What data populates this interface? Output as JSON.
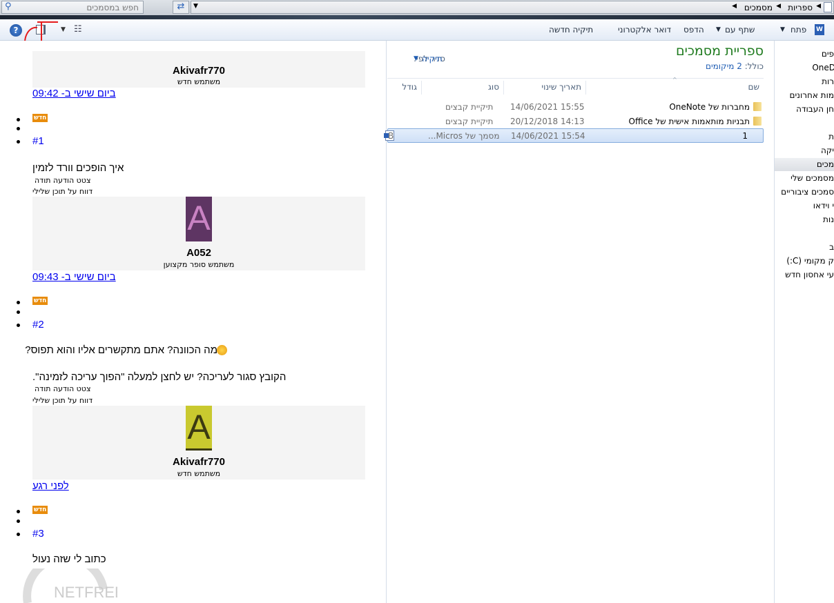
{
  "topbar": {
    "search_placeholder": "חפש במסמכים",
    "breadcrumb": [
      "ספריות",
      "מסמכים"
    ]
  },
  "toolbar": {
    "open": "פתח",
    "share": "שתף עם",
    "print": "הדפס",
    "email": "דואר אלקטרוני",
    "new_folder": "תיקיה חדשה"
  },
  "library": {
    "title": "ספריית מסמכים",
    "includes_label": "כולל:",
    "includes_value": "2 מיקומים",
    "arrange_label": "סדר לפי:",
    "arrange_value": "תיקיה"
  },
  "columns": {
    "name": "שם",
    "date": "תאריך שינוי",
    "type": "סוג",
    "size": "גודל"
  },
  "files": [
    {
      "name": "OneNote מחברות של",
      "date": "14/06/2021 15:55",
      "type": "תיקיית קבצים",
      "size": "",
      "icon": "folder-icon"
    },
    {
      "name": "תבניות מותאמות אישית של Office",
      "date": "20/12/2018 14:13",
      "type": "תיקיית קבצים",
      "size": "",
      "icon": "folder-icon"
    },
    {
      "name": "1",
      "date": "14/06/2021 15:54",
      "type": "...Micros מסמך של",
      "size": "B",
      "icon": "word-doc-icon",
      "selected": true
    }
  ],
  "nav": [
    "פים",
    "OneD",
    "רות",
    "מות אחרונים",
    "חן העבודה",
    "ת",
    "יקה",
    "מכים",
    "מסמכים שלי",
    "סמכים ציבוריים",
    "י וידאו",
    "נות",
    "ב",
    "ק מקומי (C:)",
    "עי אחסון חדש"
  ],
  "forum": {
    "new_badge": "חדש",
    "posts": [
      {
        "user": "Akivafr770",
        "rank": "משתמש חדש",
        "time": "ביום שישי ב- 09:42",
        "number": "#1",
        "body": [
          "איך הופכים וורד לזמין"
        ],
        "actions": [
          "צטט הודעה תודה",
          "דווח על תוכן שלילי"
        ]
      },
      {
        "user": "A052",
        "avatar_letter": "A",
        "avatar_color": "#5e3563",
        "rank": "משתמש סופר מקצוען",
        "time": "ביום שישי ב- 09:43",
        "number": "#2",
        "body": [
          "מה הכוונה? אתם מתקשרים אליו והוא תפוס?",
          "הקובץ סגור לעריכה? יש לחצן למעלה \"הפוך עריכה לזמינה\"."
        ],
        "actions": [
          "צטט הודעה תודה",
          "דווח על תוכן שלילי"
        ]
      },
      {
        "user": "Akivafr770",
        "avatar_letter": "A",
        "avatar_color": "#c9c92f",
        "rank": "משתמש חדש",
        "time": "לפני רגע",
        "number": "#3",
        "body": [
          "כתוב לי שזה נעול"
        ]
      }
    ]
  },
  "watermark": "NETFREE מחשב"
}
